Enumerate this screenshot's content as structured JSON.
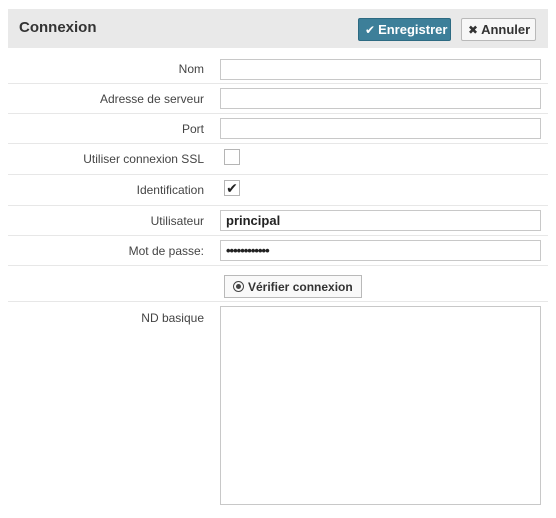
{
  "header": {
    "title": "Connexion",
    "save_label": "Enregistrer",
    "cancel_label": "Annuler"
  },
  "form": {
    "nom": {
      "label": "Nom",
      "value": ""
    },
    "server": {
      "label": "Adresse de serveur",
      "value": ""
    },
    "port": {
      "label": "Port",
      "value": ""
    },
    "ssl": {
      "label": "Utiliser connexion SSL",
      "checked": false
    },
    "identification": {
      "label": "Identification",
      "checked": true
    },
    "user": {
      "label": "Utilisateur",
      "value": "principal"
    },
    "password": {
      "label": "Mot de passe:",
      "value": "••••••••••••"
    },
    "verify_label": "Vérifier connexion",
    "basedn": {
      "label": "ND basique",
      "value": ""
    }
  },
  "colors": {
    "accent": "#3d7f99",
    "header_bg": "#e9e9e9"
  }
}
